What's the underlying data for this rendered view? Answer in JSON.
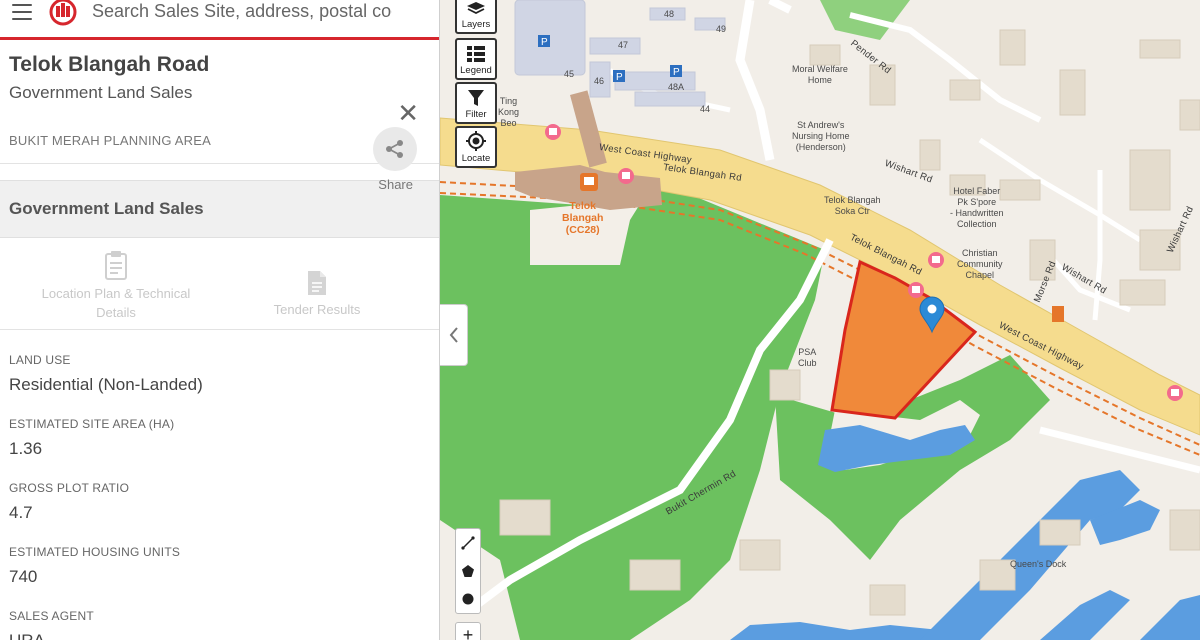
{
  "search": {
    "placeholder": "Search Sales Site, address, postal code"
  },
  "site": {
    "title": "Telok Blangah Road",
    "subtitle": "Government Land Sales",
    "planning_area": "BUKIT MERAH PLANNING AREA",
    "share_label": "Share"
  },
  "section": {
    "title": "Government Land Sales"
  },
  "documents": {
    "location_plan": "Location Plan & Technical Details",
    "tender_results": "Tender Results"
  },
  "fields": [
    {
      "label": "LAND USE",
      "value": "Residential (Non-Landed)"
    },
    {
      "label": "ESTIMATED SITE AREA (HA)",
      "value": "1.36"
    },
    {
      "label": "GROSS PLOT RATIO",
      "value": "4.7"
    },
    {
      "label": "ESTIMATED HOUSING UNITS",
      "value": "740"
    },
    {
      "label": "SALES AGENT",
      "value": "URA"
    }
  ],
  "map_controls": {
    "layers": "Layers",
    "legend": "Legend",
    "filter": "Filter",
    "locate": "Locate",
    "zoom_in": "+"
  },
  "map_labels": {
    "ting_kong_beo": "Ting\nKong\nBeo",
    "moral_welfare_home": "Moral Welfare\nHome",
    "st_andrews": "St Andrew's\nNursing Home\n(Henderson)",
    "telok_blangah_soka": "Telok Blangah\nSoka Ctr",
    "hotel_faber": "Hotel Faber\nPk S'pore\n- Handwritten\nCollection",
    "christian_chapel": "Christian\nCommunity\nChapel",
    "psa_club": "PSA\nClub",
    "queens_dock": "Queen's Dock",
    "station": "Telok\nBlangah\n(CC28)",
    "block_48": "48",
    "block_49": "49",
    "block_47": "47",
    "block_45": "45",
    "block_46": "46",
    "block_48a": "48A",
    "block_44": "44"
  },
  "road_labels": {
    "west_coast_highway_1": "West Coast Highway",
    "west_coast_highway_2": "West Coast Highway",
    "telok_blangah_rd_1": "Telok Blangah Rd",
    "telok_blangah_rd_2": "Telok Blangah Rd",
    "pender_rd": "Pender Rd",
    "wishart_rd_1": "Wishart Rd",
    "wishart_rd_2": "Wishart Rd",
    "wishart_rd_3": "Wishart Rd",
    "morse_rd": "Morse Rd",
    "bukit_chermin_rd": "Bukit Chermin Rd"
  },
  "colors": {
    "brand_red": "#d6262d",
    "site_fill": "#f0893a",
    "site_border": "#d9261c",
    "park": "#6cc15f",
    "water": "#5b9de0",
    "highway": "#f5dc8e",
    "marker": "#2b8ad6"
  }
}
